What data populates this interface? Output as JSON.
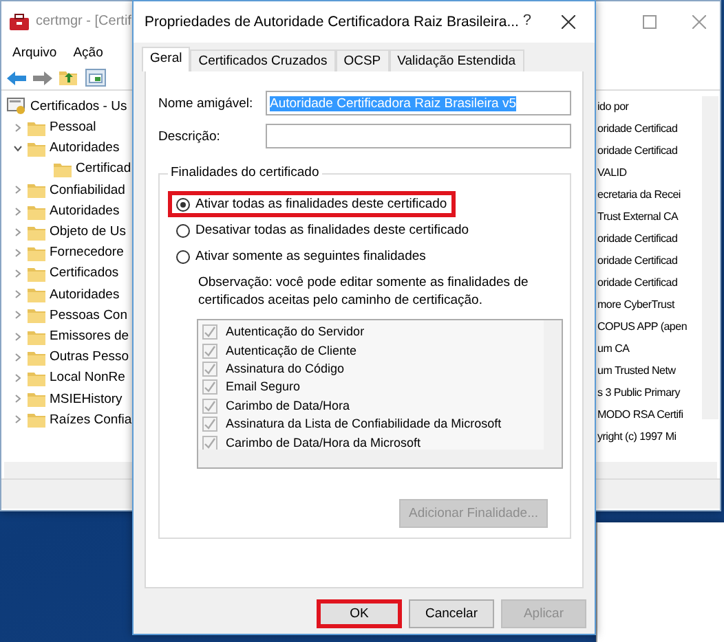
{
  "background_window": {
    "title": "certmgr - [Certif",
    "menu": [
      "Arquivo",
      "Ação"
    ],
    "tree": [
      {
        "label": "Certificados - Us",
        "children": [
          {
            "label": "Pessoal",
            "expanded": false
          },
          {
            "label": "Autoridades",
            "expanded": true,
            "children": [
              {
                "label": "Certificad"
              }
            ]
          },
          {
            "label": "Confiabilidad",
            "expanded": false
          },
          {
            "label": "Autoridades",
            "expanded": false
          },
          {
            "label": "Objeto de Us",
            "expanded": false
          },
          {
            "label": "Fornecedore",
            "expanded": false
          },
          {
            "label": "Certificados",
            "expanded": false
          },
          {
            "label": "Autoridades",
            "expanded": false
          },
          {
            "label": "Pessoas Con",
            "expanded": false
          },
          {
            "label": "Emissores de",
            "expanded": false
          },
          {
            "label": "Outras Pesso",
            "expanded": false
          },
          {
            "label": "Local NonRe",
            "expanded": false
          },
          {
            "label": "MSIEHistory",
            "expanded": false
          },
          {
            "label": "Raízes Confia",
            "expanded": false
          }
        ]
      }
    ],
    "list_header": "ido por",
    "list_rows": [
      "oridade Certificad",
      "oridade Certificad",
      "VALID",
      "ecretaria da Recei",
      "Trust External CA",
      "oridade Certificad",
      "oridade Certificad",
      "oridade Certificad",
      "more CyberTrust",
      "COPUS APP (apen",
      "um CA",
      "um Trusted Netw",
      "s 3 Public Primary",
      "MODO RSA Certifi",
      "yright (c) 1997 Mi"
    ]
  },
  "dialog": {
    "title": "Propriedades de Autoridade Certificadora Raiz Brasileira...",
    "help": "?",
    "tabs": [
      {
        "label": "Geral",
        "selected": true
      },
      {
        "label": "Certificados Cruzados",
        "selected": false
      },
      {
        "label": "OCSP",
        "selected": false
      },
      {
        "label": "Validação Estendida",
        "selected": false
      }
    ],
    "friendly_name": {
      "label": "Nome amigável:",
      "value": "Autoridade Certificadora Raiz Brasileira v5",
      "text_selected": true
    },
    "description": {
      "label": "Descrição:"
    },
    "purposes": {
      "legend": "Finalidades do certificado",
      "options": [
        {
          "label": "Ativar todas as finalidades deste certificado",
          "selected": true,
          "highlighted": true
        },
        {
          "label": "Desativar todas as finalidades deste certificado",
          "selected": false,
          "highlighted": false
        },
        {
          "label": "Ativar somente as seguintes finalidades",
          "selected": false,
          "highlighted": false
        }
      ],
      "note": "Observação: você pode editar somente as finalidades de certificados aceitas pelo caminho de certificação.",
      "items": [
        {
          "label": "Autenticação do Servidor",
          "checked": true
        },
        {
          "label": "Autenticação de Cliente",
          "checked": true
        },
        {
          "label": "Assinatura do Código",
          "checked": true
        },
        {
          "label": "Email Seguro",
          "checked": true
        },
        {
          "label": "Carimbo de Data/Hora",
          "checked": true
        },
        {
          "label": "Assinatura da Lista de Confiabilidade da Microsoft",
          "checked": true
        },
        {
          "label": "Carimbo de Data/Hora da Microsoft",
          "checked": true
        }
      ],
      "items_disabled": true,
      "add_button": {
        "label": "Adicionar Finalidade...",
        "disabled": true
      }
    },
    "buttons": [
      {
        "label": "OK",
        "disabled": false,
        "highlighted": true
      },
      {
        "label": "Cancelar",
        "disabled": false,
        "highlighted": false
      },
      {
        "label": "Aplicar",
        "disabled": true,
        "highlighted": false
      }
    ]
  }
}
